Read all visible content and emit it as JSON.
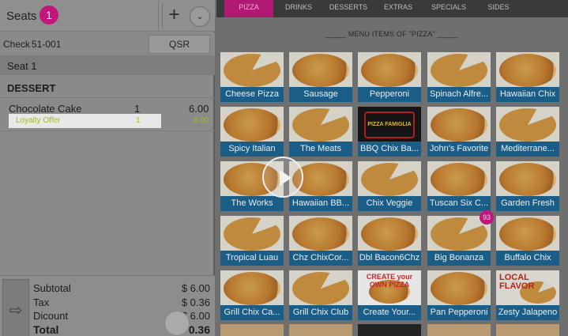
{
  "left_panel": {
    "seats_label": "Seats",
    "seat_count": "1",
    "add_icon": "plus-icon",
    "chevron_icon": "chevron-down-icon",
    "check_label": "Check",
    "check_number": "51-001",
    "order_type_button": "QSR",
    "seat_label": "Seat 1",
    "category": "DESSERT",
    "items": [
      {
        "name": "Chocolate Cake",
        "qty": "1",
        "price": "6.00"
      }
    ],
    "offer": {
      "name": "Loyalty Offer",
      "qty": "1",
      "price": "6.00"
    },
    "totals": {
      "subtotal_label": "Subtotal",
      "subtotal": "$ 6.00",
      "tax_label": "Tax",
      "tax": "$ 0.36",
      "discount_label": "Dicount",
      "discount": "$ 6.00",
      "total_label": "Total",
      "total": "$ 0.36"
    },
    "split_icon": "split-icon"
  },
  "tabs": [
    "PIZZA",
    "DRINKS",
    "DESSERTS",
    "EXTRAS",
    "SPECIALS",
    "SIDES"
  ],
  "active_tab": "PIZZA",
  "menu_title": "_____ MENU ITEMS OF \"PIZZA\" _____",
  "menu_items": [
    "Cheese Pizza",
    "Sausage",
    "Pepperoni",
    "Spinach Alfre...",
    "Hawaiian Chix",
    "Spicy Italian",
    "The Meats",
    "BBQ Chix Ba...",
    "John's Favorite",
    "Mediterrane...",
    "The Works",
    "Hawaiian BB...",
    "Chix Veggie",
    "Tuscan Six C...",
    "Garden Fresh",
    "Tropical Luau",
    "Chz ChixCor...",
    "Dbl Bacon6Chz",
    "Big Bonanza",
    "Buffalo Chix",
    "Grill Chix Ca...",
    "Grill Chix Club",
    "Create Your...",
    "Pan Pepperoni",
    "Zesty Jalapeno"
  ],
  "tile_texts": {
    "logo": "PIZZA FAMIGLIA",
    "create": "CREATE your OWN PIZZA",
    "flavor": "LOCAL FLAVOR"
  },
  "item_badge": "93",
  "play_icon": "play-icon"
}
